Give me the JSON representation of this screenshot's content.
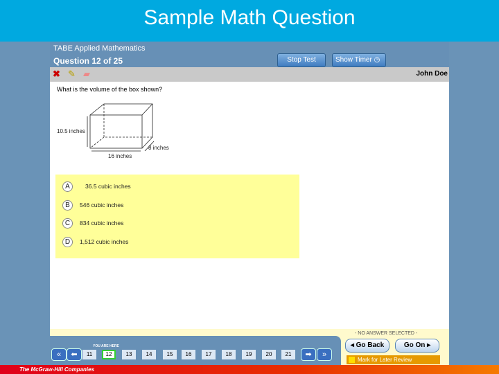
{
  "slide_title": "Sample Math Question",
  "header": {
    "subject": "TABE Applied Mathematics",
    "question": "Question 12  of  25",
    "stop_test": "Stop Test",
    "show_timer": "Show Timer",
    "user": "John Doe"
  },
  "question": {
    "text": "What is the volume of the box shown?",
    "labels": {
      "height": "10.5 inches",
      "depth": "8 inches",
      "width": "16 inches"
    }
  },
  "options": [
    {
      "letter": "A",
      "text": "36.5 cubic inches"
    },
    {
      "letter": "B",
      "text": "546 cubic inches"
    },
    {
      "letter": "C",
      "text": "834 cubic inches"
    },
    {
      "letter": "D",
      "text": "1,512 cubic inches"
    }
  ],
  "nav": {
    "you_are_here": "YOU ARE HERE",
    "pages": [
      "11",
      "12",
      "13",
      "14",
      "15",
      "16",
      "17",
      "18",
      "19",
      "20",
      "21"
    ],
    "current": "12",
    "status": "- NO ANSWER SELECTED -",
    "go_back": "◂ Go Back",
    "go_on": "Go On ▸",
    "mark_review": "Mark for Later Review"
  },
  "footer": "The McGraw-Hill Companies"
}
